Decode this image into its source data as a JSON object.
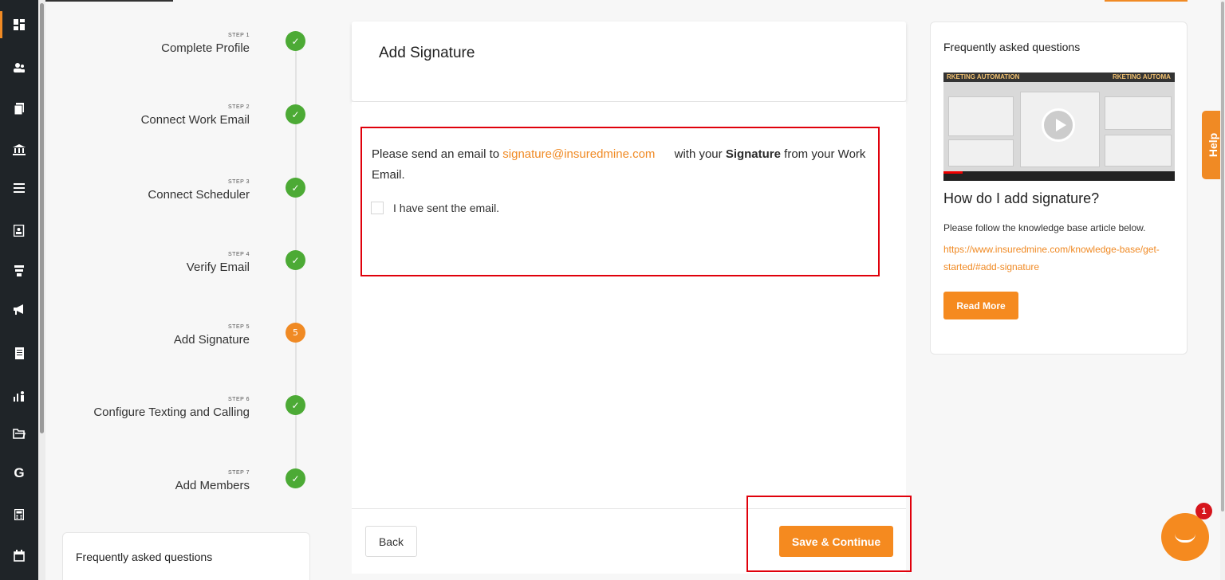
{
  "sidebar": {
    "icons": [
      "dashboard-icon",
      "contacts-icon",
      "documents-icon",
      "bank-icon",
      "list-icon",
      "id-card-icon",
      "funnel-icon",
      "megaphone-icon",
      "report-icon",
      "analytics-icon",
      "folder-icon",
      "google-icon",
      "calculator-icon",
      "calendar-icon"
    ],
    "google_label": "G"
  },
  "steps": [
    {
      "num": "STEP 1",
      "name": "Complete Profile",
      "status": "done",
      "mark": "✓"
    },
    {
      "num": "STEP 2",
      "name": "Connect Work Email",
      "status": "done",
      "mark": "✓"
    },
    {
      "num": "STEP 3",
      "name": "Connect Scheduler",
      "status": "done",
      "mark": "✓"
    },
    {
      "num": "STEP 4",
      "name": "Verify Email",
      "status": "done",
      "mark": "✓"
    },
    {
      "num": "STEP 5",
      "name": "Add Signature",
      "status": "current",
      "mark": "5"
    },
    {
      "num": "STEP 6",
      "name": "Configure Texting and Calling",
      "status": "done",
      "mark": "✓"
    },
    {
      "num": "STEP 7",
      "name": "Add Members",
      "status": "done",
      "mark": "✓"
    }
  ],
  "left_faq_title": "Frequently asked questions",
  "main": {
    "title": "Add Signature",
    "msg_prefix": "Please send an email to",
    "email": "signature@insuredmine.com",
    "msg_mid": "with your",
    "msg_bold": "Signature",
    "msg_suffix": "from your Work Email.",
    "checkbox_label": "I have sent the email.",
    "back_label": "Back",
    "save_label": "Save & Continue"
  },
  "faq": {
    "title": "Frequently asked questions",
    "video_text_left": "RKETING AUTOMATION",
    "video_text_right": "RKETING AUTOMA",
    "question": "How do I add signature?",
    "desc": "Please follow the knowledge base article below.",
    "link": "https://www.insuredmine.com/knowledge-base/get-started/#add-signature",
    "read_more": "Read More"
  },
  "help_label": "Help",
  "chat_badge": "1",
  "colors": {
    "accent": "#f08a24",
    "success": "#4caa35",
    "highlight": "#e0000b",
    "sidebar": "#1f2428"
  }
}
